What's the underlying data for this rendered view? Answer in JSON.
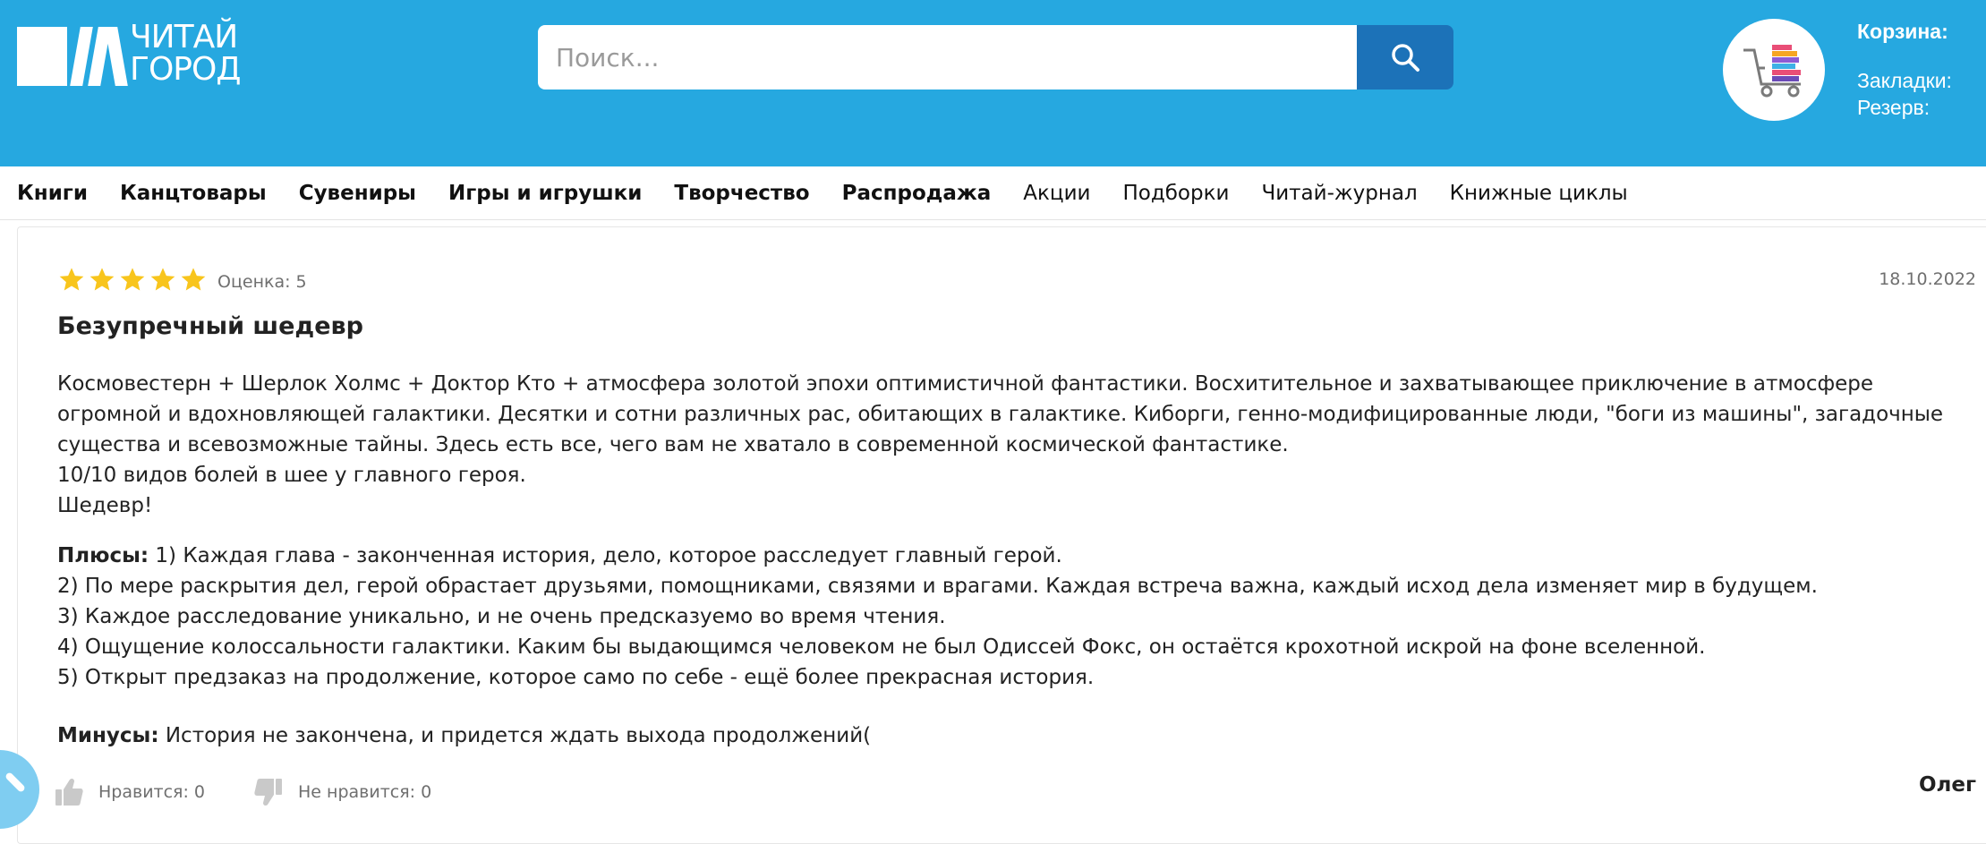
{
  "header": {
    "logo": {
      "line1": "ЧИТАЙ",
      "line2": "ГОРОД"
    },
    "search": {
      "placeholder": "Поиск..."
    },
    "user_links": {
      "cart": "Корзина:",
      "bookmarks": "Закладки:",
      "reserve": "Резерв:"
    }
  },
  "nav": {
    "items": [
      {
        "label": "Книги",
        "bold": true
      },
      {
        "label": "Канцтовары",
        "bold": true
      },
      {
        "label": "Сувениры",
        "bold": true
      },
      {
        "label": "Игры и игрушки",
        "bold": true
      },
      {
        "label": "Творчество",
        "bold": true
      },
      {
        "label": "Распродажа",
        "bold": true
      },
      {
        "label": "Акции",
        "bold": false
      },
      {
        "label": "Подборки",
        "bold": false
      },
      {
        "label": "Читай-журнал",
        "bold": false
      },
      {
        "label": "Книжные циклы",
        "bold": false
      }
    ]
  },
  "review": {
    "rating_value": 5,
    "rating_max": 5,
    "rating_label": "Оценка: 5",
    "date": "18.10.2022",
    "title": "Безупречный шедевр",
    "body": [
      "Космовестерн + Шерлок Холмс + Доктор Кто + атмосфера золотой эпохи оптимистичной фантастики. Восхитительное и захватывающее приключение в атмосфере",
      "огромной и вдохновляющей галактики. Десятки и сотни различных рас, обитающих в галактике. Киборги, генно-модифицированные люди, \"боги из машины\", загадочные",
      "существа и всевозможные тайны. Здесь есть все, чего вам не хватало в современной космической фантастике.",
      "10/10 видов болей в шее у главного героя.",
      "Шедевр!"
    ],
    "pros_label": "Плюсы:",
    "pros": [
      "1) Каждая глава - законченная история, дело, которое расследует главный герой.",
      "2) По мере раскрытия дел, герой обрастает друзьями, помощниками, связями и врагами. Каждая встреча важна, каждый исход дела изменяет мир в будущем.",
      "3) Каждое расследование уникально, и не очень предсказуемо во время чтения.",
      "4) Ощущение колоссальности галактики. Каким бы выдающимся человеком не был Одиссей Фокс, он остаётся крохотной искрой на фоне вселенной.",
      "5) Открыт предзаказ на продолжение, которое само по себе - ещё более прекрасная история."
    ],
    "cons_label": "Минусы:",
    "cons": "История не закончена, и придется ждать выхода продолжений(",
    "likes_label": "Нравится: 0",
    "dislikes_label": "Не нравится: 0",
    "author": "Олег"
  },
  "colors": {
    "header_bg": "#26a8e0",
    "search_button": "#1c72b8",
    "star": "#f8c51c",
    "muted_icon": "#c9c9c9"
  },
  "icons": {
    "search": "search-icon",
    "cart": "cart-icon",
    "like": "thumbs-up-icon",
    "dislike": "thumbs-down-icon",
    "star": "star-icon"
  }
}
